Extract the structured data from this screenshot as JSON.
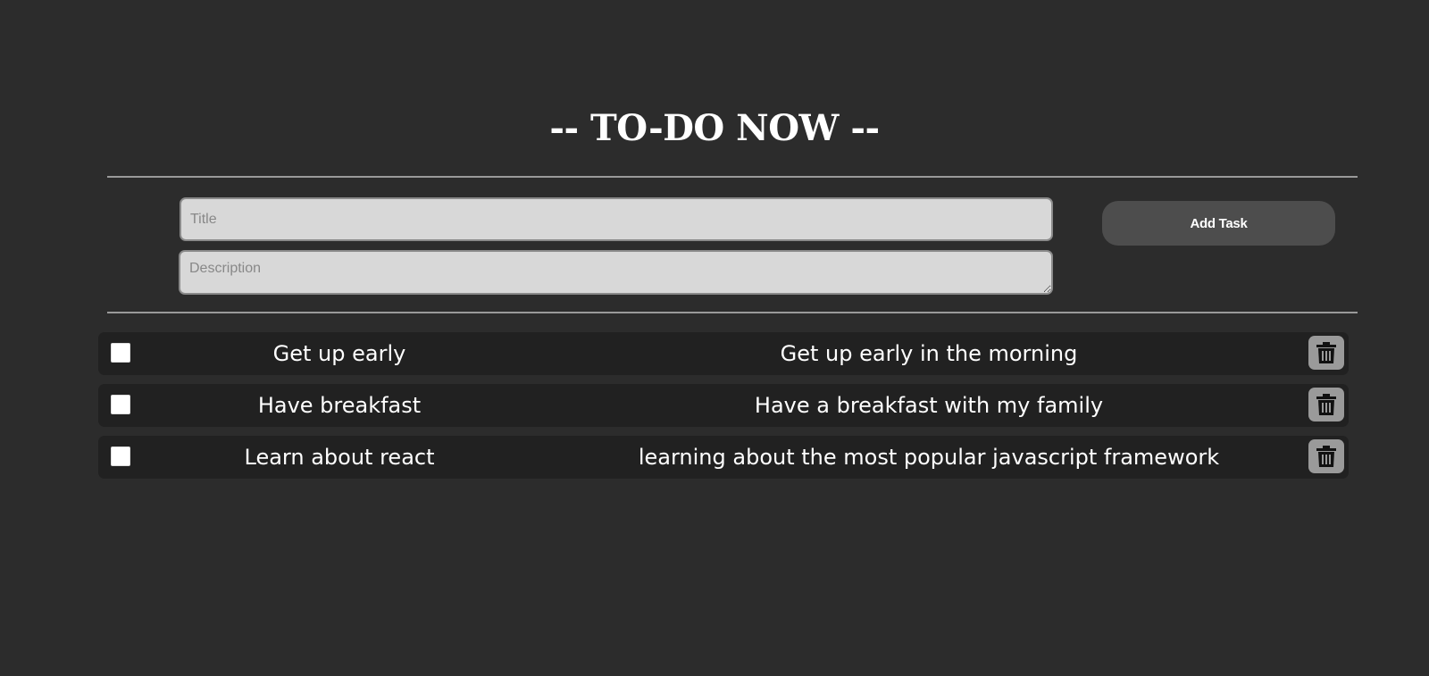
{
  "header": {
    "title": "-- TO-DO NOW --"
  },
  "form": {
    "title_placeholder": "Title",
    "title_value": "",
    "description_placeholder": "Description",
    "description_value": "",
    "add_button_label": "Add Task"
  },
  "tasks": [
    {
      "title": "Get up early",
      "description": "Get up early in the morning",
      "checked": false
    },
    {
      "title": "Have breakfast",
      "description": "Have a breakfast with my family",
      "checked": false
    },
    {
      "title": "Learn about react",
      "description": "learning about the most popular javascript framework",
      "checked": false
    }
  ],
  "icons": {
    "delete": "trash-icon"
  },
  "colors": {
    "background": "#2c2c2c",
    "task_row": "#212121",
    "button": "#4d4d4d",
    "delete_button": "#9a9a9a",
    "input": "#d8d8d8"
  }
}
